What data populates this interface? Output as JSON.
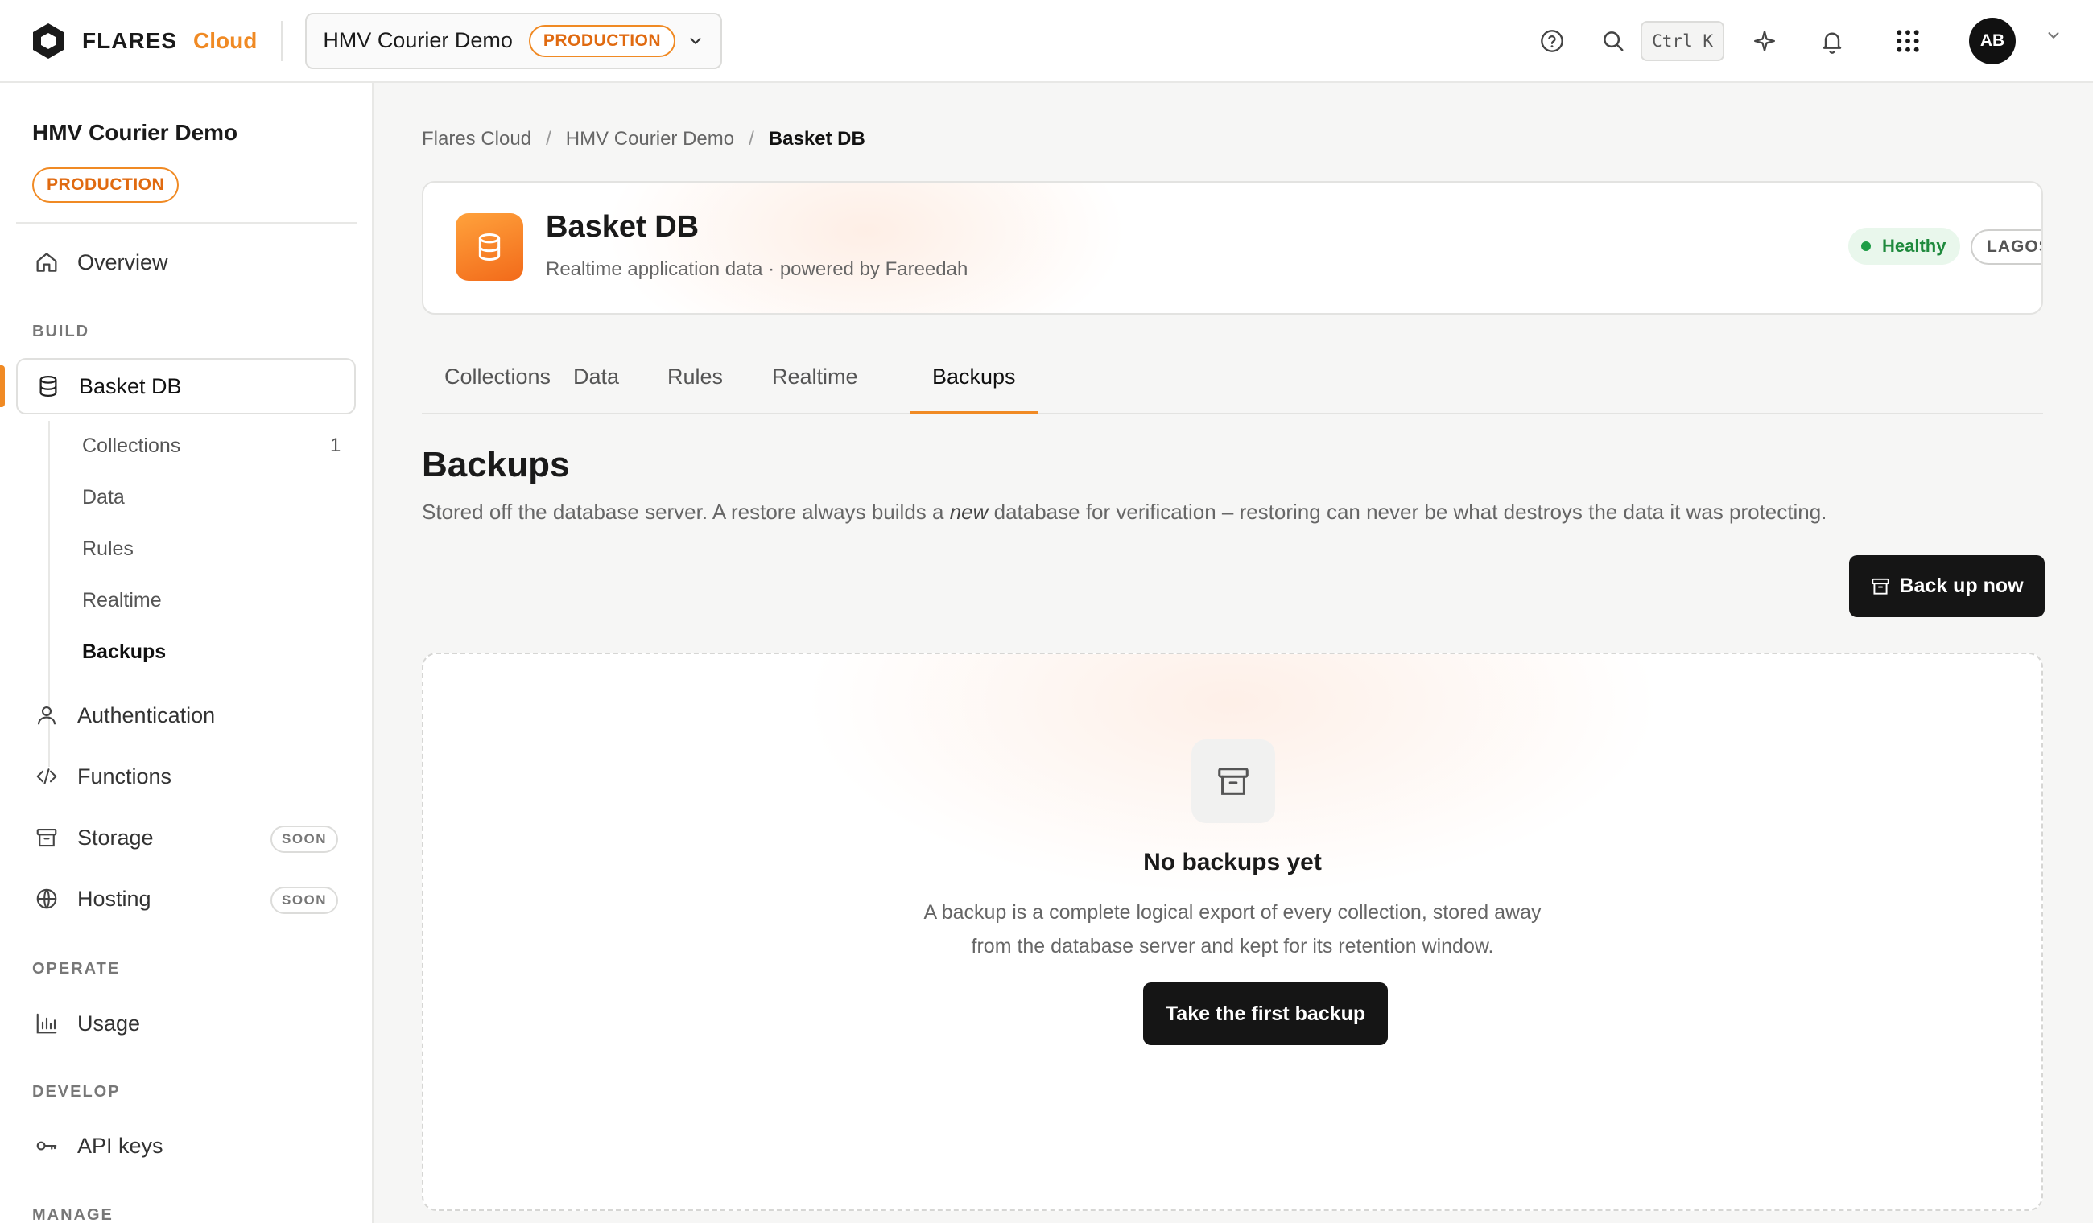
{
  "topbar": {
    "brand_name": "FLARES",
    "brand_cloud": "Cloud",
    "project_name": "HMV Courier Demo",
    "env_badge": "PRODUCTION",
    "shortcut": "Ctrl K",
    "avatar_initials": "AB"
  },
  "sidebar": {
    "project_name": "HMV Courier Demo",
    "env_badge": "PRODUCTION",
    "overview": "Overview",
    "section_build": "BUILD",
    "database": "Basket DB",
    "sub_items": [
      {
        "label": "Collections",
        "count": "1"
      },
      {
        "label": "Data"
      },
      {
        "label": "Rules"
      },
      {
        "label": "Realtime"
      },
      {
        "label": "Backups"
      }
    ],
    "authentication": "Authentication",
    "functions": "Functions",
    "storage": "Storage",
    "hosting": "Hosting",
    "soon_badge": "SOON",
    "section_operate": "OPERATE",
    "usage": "Usage",
    "section_develop": "DEVELOP",
    "api_keys": "API keys",
    "section_manage": "MANAGE"
  },
  "breadcrumb": [
    "Flares Cloud",
    "HMV Courier Demo",
    "Basket DB"
  ],
  "db": {
    "title": "Basket DB",
    "subtitle": "Realtime application data · powered by Fareedah",
    "status": "Healthy",
    "region": "LAGOS"
  },
  "tabs": [
    "Collections",
    "Data",
    "Rules",
    "Realtime",
    "Backups"
  ],
  "backups": {
    "title": "Backups",
    "desc_before": "Stored off the database server. A restore always builds a ",
    "desc_em": "new",
    "desc_after": " database for verification – restoring can never be what destroys the data it was protecting.",
    "backup_now": "Back up now",
    "empty_title": "No backups yet",
    "empty_desc_1": "A backup is a complete logical export of every collection, stored away",
    "empty_desc_2": "from the database server and kept for its retention window.",
    "first_backup": "Take the first backup"
  },
  "colors": {
    "accent": "#f08a24",
    "healthy": "#1f8a3d",
    "dark_button": "#151515"
  },
  "icons": [
    "flares-logo-icon",
    "chevron-down-icon",
    "help-icon",
    "search-icon",
    "sparkle-icon",
    "bell-icon",
    "apps-grid-icon",
    "home-icon",
    "database-icon",
    "user-icon",
    "code-icon",
    "archive-icon",
    "globe-icon",
    "bar-chart-icon",
    "key-icon"
  ]
}
